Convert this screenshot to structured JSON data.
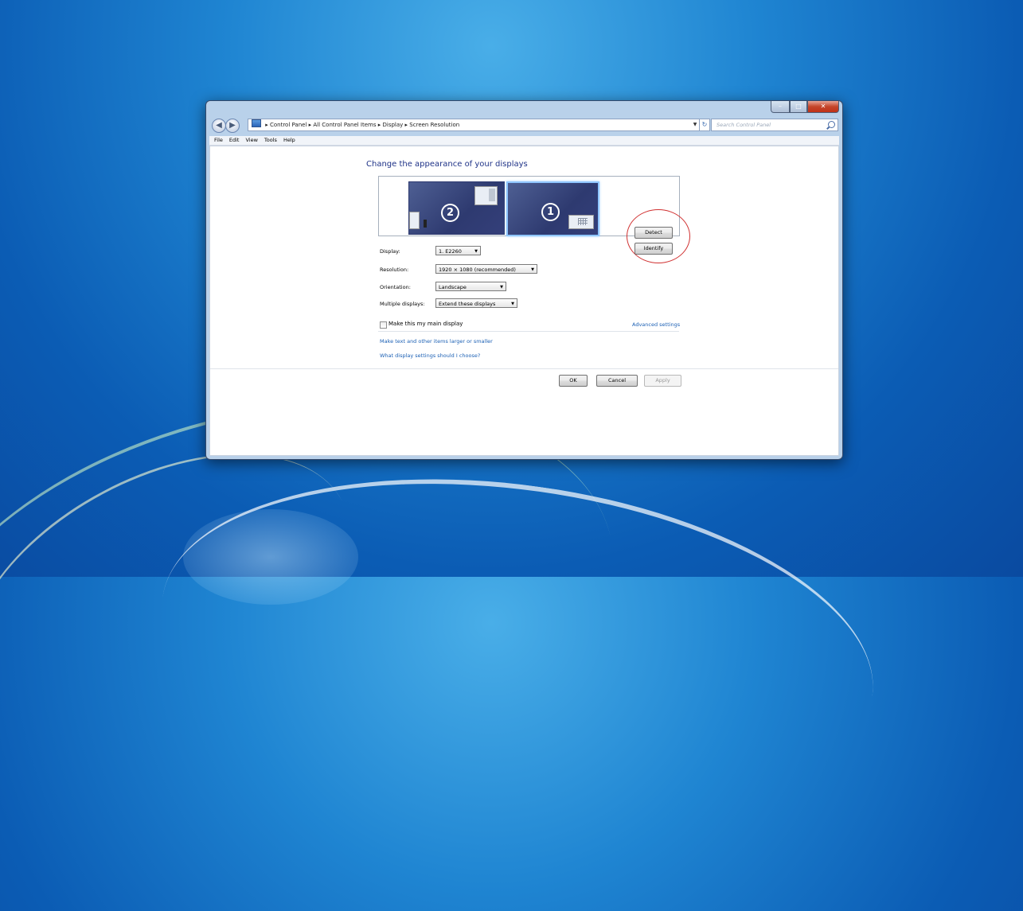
{
  "window": {
    "breadcrumb": [
      "Control Panel",
      "All Control Panel Items",
      "Display",
      "Screen Resolution"
    ],
    "search_placeholder": "Search Control Panel",
    "menu": [
      "File",
      "Edit",
      "View",
      "Tools",
      "Help"
    ]
  },
  "main": {
    "heading": "Change the appearance of your displays",
    "monitors": {
      "secondary": "2",
      "primary": "1"
    },
    "detect_label": "Detect",
    "identify_label": "Identify",
    "display_label": "Display:",
    "display_value": "1. E2260",
    "resolution_label": "Resolution:",
    "resolution_value": "1920 × 1080 (recommended)",
    "orientation_label": "Orientation:",
    "orientation_value": "Landscape",
    "multiple_label": "Multiple displays:",
    "multiple_value": "Extend these displays",
    "main_display_label": "Make this my main display",
    "main_display_checked": false,
    "advanced_link": "Advanced settings",
    "link_text_size": "Make text and other items larger or smaller",
    "link_what_settings": "What display settings should I choose?",
    "ok_label": "OK",
    "cancel_label": "Cancel",
    "apply_label": "Apply"
  },
  "colors": {
    "heading": "#1e3287",
    "link": "#1a5fb4",
    "highlight_circle": "#d03030"
  }
}
